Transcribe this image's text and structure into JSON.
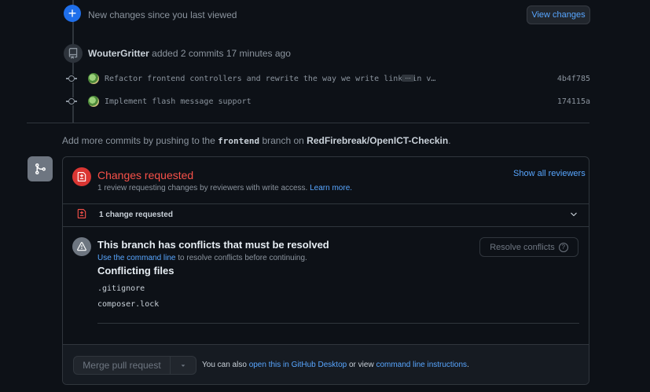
{
  "timeline": {
    "new_changes_text": "New changes since you last viewed",
    "view_changes_label": "View changes",
    "push_event": {
      "user": "WouterGritter",
      "action": "added 2 commits 17 minutes ago"
    },
    "commits": [
      {
        "message": "Refactor frontend controllers and rewrite the way we write links in v…",
        "sha": "4b4f785",
        "has_ellipsis": true
      },
      {
        "message": "Implement flash message support",
        "sha": "174115a",
        "has_ellipsis": false
      }
    ],
    "ellipsis": "…"
  },
  "add_more": {
    "prefix": "Add more commits by pushing to the",
    "branch": "frontend",
    "middle": "branch on",
    "repo": "RedFirebreak/OpenICT-Checkin",
    "suffix": "."
  },
  "review": {
    "title": "Changes requested",
    "subtitle": "1 review requesting changes by reviewers with write access.",
    "learn_more": "Learn more.",
    "show_all": "Show all reviewers",
    "change_count_label": "1 change requested"
  },
  "conflicts": {
    "title": "This branch has conflicts that must be resolved",
    "cmdline_link": "Use the command line",
    "cmdline_rest": "to resolve conflicts before continuing.",
    "resolve_label": "Resolve conflicts",
    "help_glyph": "?",
    "files_title": "Conflicting files",
    "files": [
      ".gitignore",
      "composer.lock"
    ]
  },
  "merge": {
    "button_label": "Merge pull request",
    "also_prefix": "You can also",
    "desktop_link": "open this in GitHub Desktop",
    "or_view": "or view",
    "cli_link": "command line instructions",
    "suffix": "."
  },
  "colors": {
    "accent": "#58a6ff",
    "danger": "#f85149",
    "badge_blue": "#1f6feb",
    "background": "#0d1117"
  },
  "icons": [
    "plus-icon",
    "repo-push-icon",
    "git-commit-icon",
    "git-merge-icon",
    "file-diff-icon",
    "alert-icon",
    "chevron-down-icon",
    "triangle-down-icon",
    "question-icon"
  ]
}
